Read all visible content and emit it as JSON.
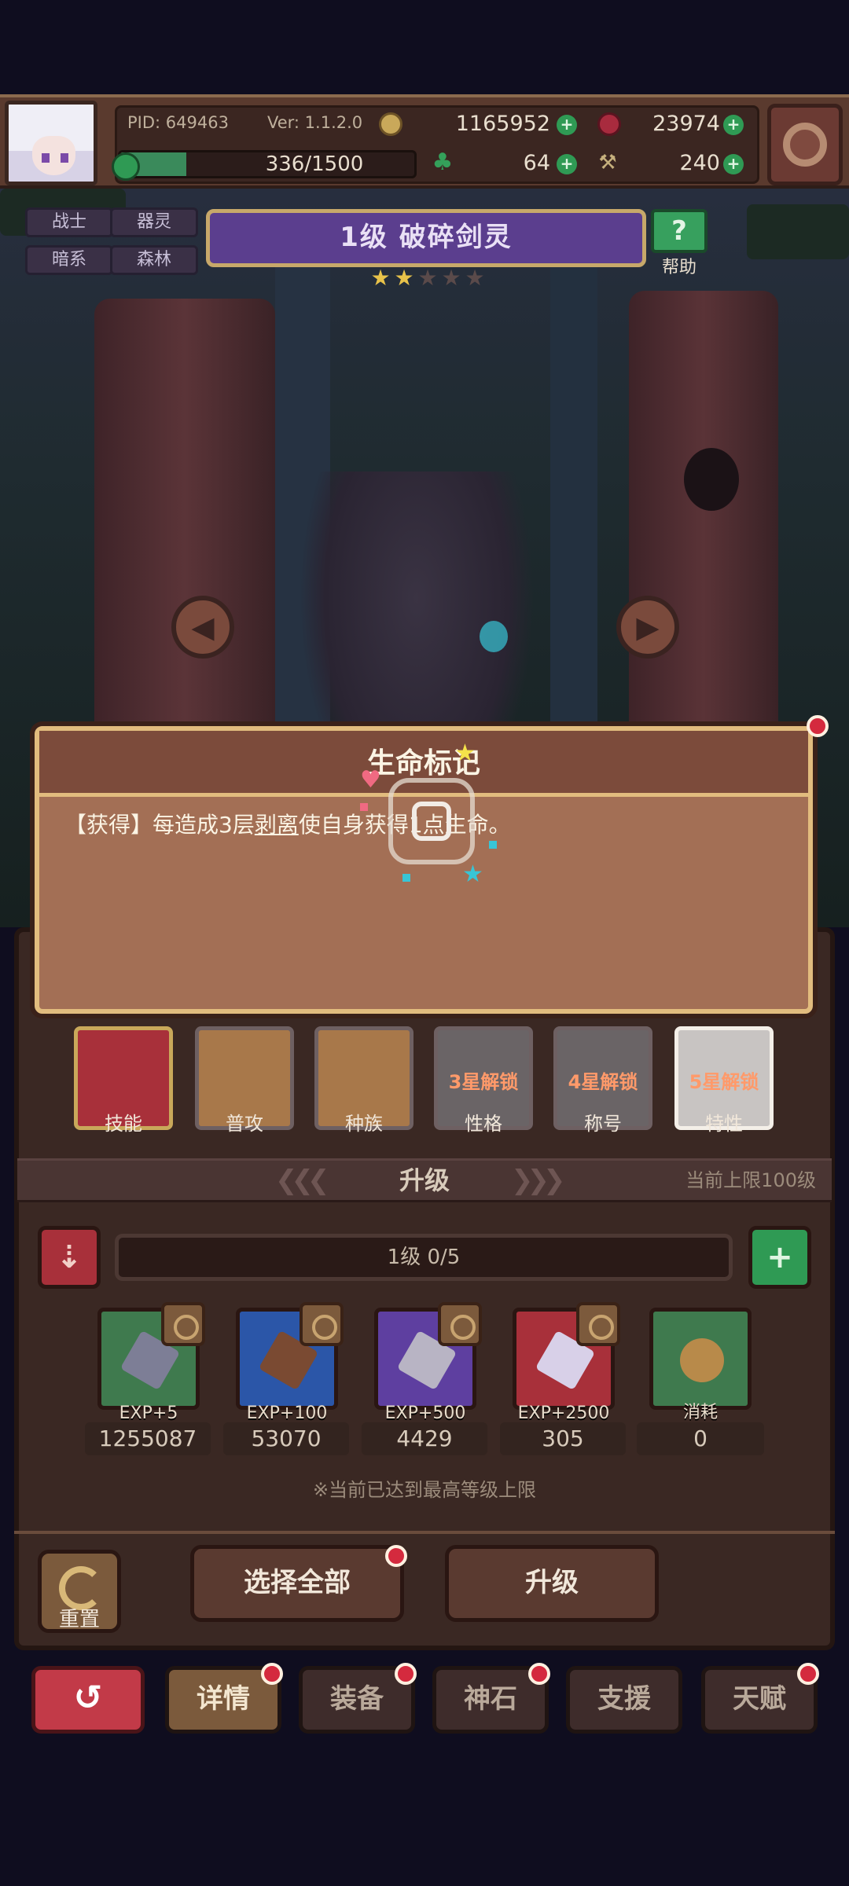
{
  "header": {
    "pid_label": "PID: 649463",
    "version": "Ver: 1.1.2.0",
    "gold": "1165952",
    "gems": "23974",
    "exp_text": "336/1500",
    "exp_fraction": 0.224,
    "clover_count": "64",
    "hammer_count": "240"
  },
  "tags": [
    "战士",
    "器灵",
    "暗系",
    "森林"
  ],
  "character": {
    "name_banner": "1级  破碎剑灵",
    "stars_total": 5,
    "stars_filled": 2,
    "help_label": "帮助"
  },
  "tooltip": {
    "title": "生命标记",
    "prefix": "【获得】每造成3层",
    "keyword": "剥离",
    "suffix": "使自身获得1点生命。"
  },
  "tabs": [
    {
      "label": "技能",
      "lock": ""
    },
    {
      "label": "普攻",
      "lock": ""
    },
    {
      "label": "种族",
      "lock": ""
    },
    {
      "label": "性格",
      "lock": "3星解锁"
    },
    {
      "label": "称号",
      "lock": "4星解锁"
    },
    {
      "label": "特性",
      "lock": "5星解锁"
    }
  ],
  "upgrade": {
    "section_title": "升级",
    "limit_text": "当前上限100级",
    "level_text": "1级  0/5",
    "items": [
      {
        "exp": "EXP+5",
        "count": "1255087",
        "color": "#3f7a4e"
      },
      {
        "exp": "EXP+100",
        "count": "53070",
        "color": "#2b56a8"
      },
      {
        "exp": "EXP+500",
        "count": "4429",
        "color": "#5e3fa0"
      },
      {
        "exp": "EXP+2500",
        "count": "305",
        "color": "#a8303a"
      },
      {
        "exp": "消耗",
        "count": "0",
        "color": "#3f7a4e"
      }
    ],
    "note": "※当前已达到最高等级上限"
  },
  "actions": {
    "reset_label": "重置",
    "select_all": "选择全部",
    "upgrade_btn": "升级"
  },
  "nav": [
    "详情",
    "装备",
    "神石",
    "支援",
    "天赋"
  ],
  "colors": {
    "accent_gold": "#e2bc7e",
    "banner_purple": "#5b3e8e",
    "alert_red": "#d42a3e"
  }
}
